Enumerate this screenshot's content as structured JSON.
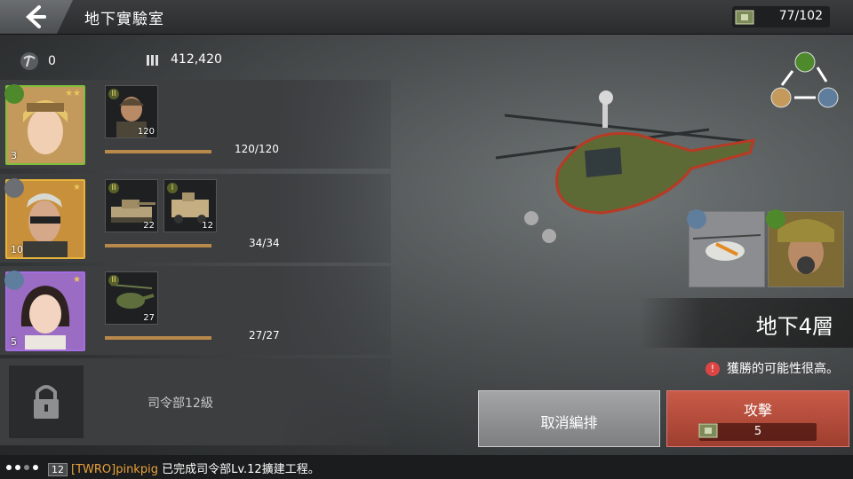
{
  "header": {
    "title": "地下實驗室",
    "capacity": "77/102"
  },
  "resources": {
    "pickaxe_count": "0",
    "ammo_count": "412,420"
  },
  "squads": [
    {
      "level": "3",
      "units": [
        {
          "count": "120",
          "rank": "II"
        }
      ],
      "progress_text": "120/120",
      "progress": 1.0
    },
    {
      "level": "10",
      "units": [
        {
          "count": "22",
          "rank": "II"
        },
        {
          "count": "12",
          "rank": "I"
        }
      ],
      "progress_text": "34/34",
      "progress": 1.0
    },
    {
      "level": "5",
      "units": [
        {
          "count": "27",
          "rank": "II"
        }
      ],
      "progress_text": "27/27",
      "progress": 1.0
    }
  ],
  "locked_slot": {
    "text": "司令部12級"
  },
  "enemy": {
    "floor": "地下4層",
    "win_text": "獲勝的可能性很高。"
  },
  "actions": {
    "cancel_label": "取消編排",
    "attack_label": "攻擊",
    "attack_cost": "5"
  },
  "chat": {
    "level": "12",
    "name": "[TWRO]pinkpig",
    "message": "已完成司令部Lv.12擴建工程。"
  },
  "colors": {
    "accent_orange": "#e8a23c",
    "attack_red": "#b84c3b",
    "bar_gold": "#b9894b"
  }
}
